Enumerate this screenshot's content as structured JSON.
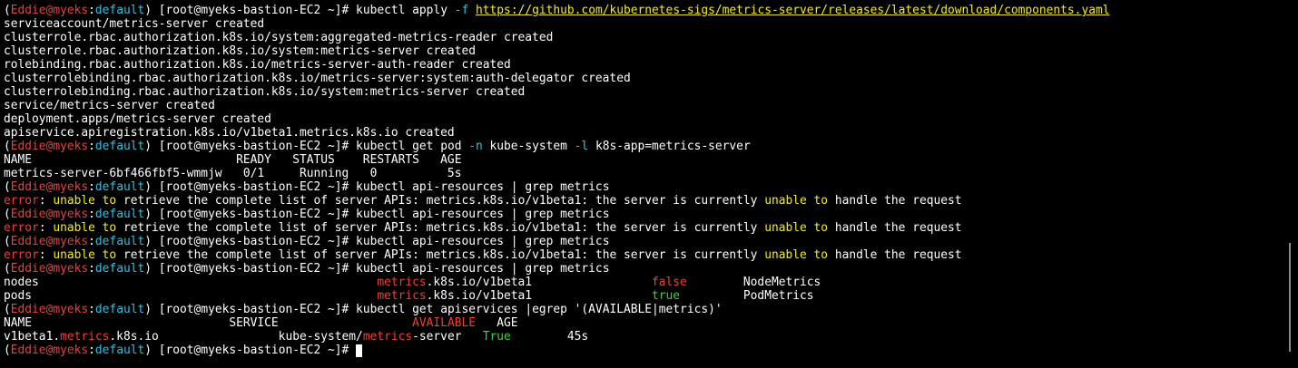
{
  "terminal": {
    "lines": [
      [
        [
          "(",
          "c-white"
        ],
        [
          "Eddie@myeks",
          "c-red"
        ],
        [
          ":",
          "c-white"
        ],
        [
          "default",
          "c-cyan"
        ],
        [
          ") [root@myeks-bastion-EC2 ~]# kubectl apply ",
          "c-white"
        ],
        [
          "-f",
          "c-cyan"
        ],
        [
          " ",
          "c-white"
        ],
        [
          "https://github.com/kubernetes-sigs/metrics-server/releases/latest/download/components.yaml",
          "c-yellow u"
        ]
      ],
      [
        [
          "serviceaccount/metrics-server created",
          "c-white"
        ]
      ],
      [
        [
          "clusterrole.rbac.authorization.k8s.io/system:aggregated-metrics-reader created",
          "c-white"
        ]
      ],
      [
        [
          "clusterrole.rbac.authorization.k8s.io/system:metrics-server created",
          "c-white"
        ]
      ],
      [
        [
          "rolebinding.rbac.authorization.k8s.io/metrics-server-auth-reader created",
          "c-white"
        ]
      ],
      [
        [
          "clusterrolebinding.rbac.authorization.k8s.io/metrics-server:system:auth-delegator created",
          "c-white"
        ]
      ],
      [
        [
          "clusterrolebinding.rbac.authorization.k8s.io/system:metrics-server created",
          "c-white"
        ]
      ],
      [
        [
          "service/metrics-server created",
          "c-white"
        ]
      ],
      [
        [
          "deployment.apps/metrics-server created",
          "c-white"
        ]
      ],
      [
        [
          "apiservice.apiregistration.k8s.io/v1beta1.metrics.k8s.io created",
          "c-white"
        ]
      ],
      [
        [
          "(",
          "c-white"
        ],
        [
          "Eddie@myeks",
          "c-red"
        ],
        [
          ":",
          "c-white"
        ],
        [
          "default",
          "c-cyan"
        ],
        [
          ") [root@myeks-bastion-EC2 ~]# kubectl get pod ",
          "c-white"
        ],
        [
          "-n",
          "c-cyan"
        ],
        [
          " kube-system ",
          "c-white"
        ],
        [
          "-l",
          "c-cyan"
        ],
        [
          " k8s-app=metrics-server",
          "c-white"
        ]
      ],
      [
        [
          "NAME                             READY   STATUS    RESTARTS   AGE",
          "c-white"
        ]
      ],
      [
        [
          "metrics-server-6bf466fbf5-wmmjw   0/1     Running   0          5s",
          "c-white"
        ]
      ],
      [
        [
          "(",
          "c-white"
        ],
        [
          "Eddie@myeks",
          "c-red"
        ],
        [
          ":",
          "c-white"
        ],
        [
          "default",
          "c-cyan"
        ],
        [
          ") [root@myeks-bastion-EC2 ~]# kubectl api-resources | grep metrics",
          "c-white"
        ]
      ],
      [
        [
          "error",
          "c-red"
        ],
        [
          ": ",
          "c-white"
        ],
        [
          "unable to",
          "c-yellow"
        ],
        [
          " retrieve the complete list of server APIs: metrics.k8s.io/v1beta1: the server is currently ",
          "c-white"
        ],
        [
          "unable to",
          "c-yellow"
        ],
        [
          " handle the request",
          "c-white"
        ]
      ],
      [
        [
          "(",
          "c-white"
        ],
        [
          "Eddie@myeks",
          "c-red"
        ],
        [
          ":",
          "c-white"
        ],
        [
          "default",
          "c-cyan"
        ],
        [
          ") [root@myeks-bastion-EC2 ~]# kubectl api-resources | grep metrics",
          "c-white"
        ]
      ],
      [
        [
          "error",
          "c-red"
        ],
        [
          ": ",
          "c-white"
        ],
        [
          "unable to",
          "c-yellow"
        ],
        [
          " retrieve the complete list of server APIs: metrics.k8s.io/v1beta1: the server is currently ",
          "c-white"
        ],
        [
          "unable to",
          "c-yellow"
        ],
        [
          " handle the request",
          "c-white"
        ]
      ],
      [
        [
          "(",
          "c-white"
        ],
        [
          "Eddie@myeks",
          "c-red"
        ],
        [
          ":",
          "c-white"
        ],
        [
          "default",
          "c-cyan"
        ],
        [
          ") [root@myeks-bastion-EC2 ~]# kubectl api-resources | grep metrics",
          "c-white"
        ]
      ],
      [
        [
          "error",
          "c-red"
        ],
        [
          ": ",
          "c-white"
        ],
        [
          "unable to",
          "c-yellow"
        ],
        [
          " retrieve the complete list of server APIs: metrics.k8s.io/v1beta1: the server is currently ",
          "c-white"
        ],
        [
          "unable to",
          "c-yellow"
        ],
        [
          " handle the request",
          "c-white"
        ]
      ],
      [
        [
          "(",
          "c-white"
        ],
        [
          "Eddie@myeks",
          "c-red"
        ],
        [
          ":",
          "c-white"
        ],
        [
          "default",
          "c-cyan"
        ],
        [
          ") [root@myeks-bastion-EC2 ~]# kubectl api-resources | grep metrics",
          "c-white"
        ]
      ],
      [
        [
          "nodes                                                ",
          "c-white"
        ],
        [
          "metrics",
          "c-red"
        ],
        [
          ".k8s.io/v1beta1                 ",
          "c-white"
        ],
        [
          "false",
          "c-red"
        ],
        [
          "        NodeMetrics",
          "c-white"
        ]
      ],
      [
        [
          "pods                                                 ",
          "c-white"
        ],
        [
          "metrics",
          "c-red"
        ],
        [
          ".k8s.io/v1beta1                 ",
          "c-white"
        ],
        [
          "true",
          "c-green"
        ],
        [
          "         PodMetrics",
          "c-white"
        ]
      ],
      [
        [
          "(",
          "c-white"
        ],
        [
          "Eddie@myeks",
          "c-red"
        ],
        [
          ":",
          "c-white"
        ],
        [
          "default",
          "c-cyan"
        ],
        [
          ") [root@myeks-bastion-EC2 ~]# kubectl get apiservices |egrep '(AVAILABLE|metrics)'",
          "c-white"
        ]
      ],
      [
        [
          "NAME                            SERVICE                   ",
          "c-white"
        ],
        [
          "AVAILABLE",
          "c-red"
        ],
        [
          "   AGE",
          "c-white"
        ]
      ],
      [
        [
          "v1beta1.",
          "c-white"
        ],
        [
          "metrics",
          "c-red"
        ],
        [
          ".k8s.io                 kube-system/",
          "c-white"
        ],
        [
          "metrics",
          "c-red"
        ],
        [
          "-server   ",
          "c-white"
        ],
        [
          "True",
          "c-green"
        ],
        [
          "        45s",
          "c-white"
        ]
      ],
      [
        [
          "(",
          "c-white"
        ],
        [
          "Eddie@myeks",
          "c-red"
        ],
        [
          ":",
          "c-white"
        ],
        [
          "default",
          "c-cyan"
        ],
        [
          ") [root@myeks-bastion-EC2 ~]# ",
          "c-white"
        ]
      ]
    ]
  }
}
